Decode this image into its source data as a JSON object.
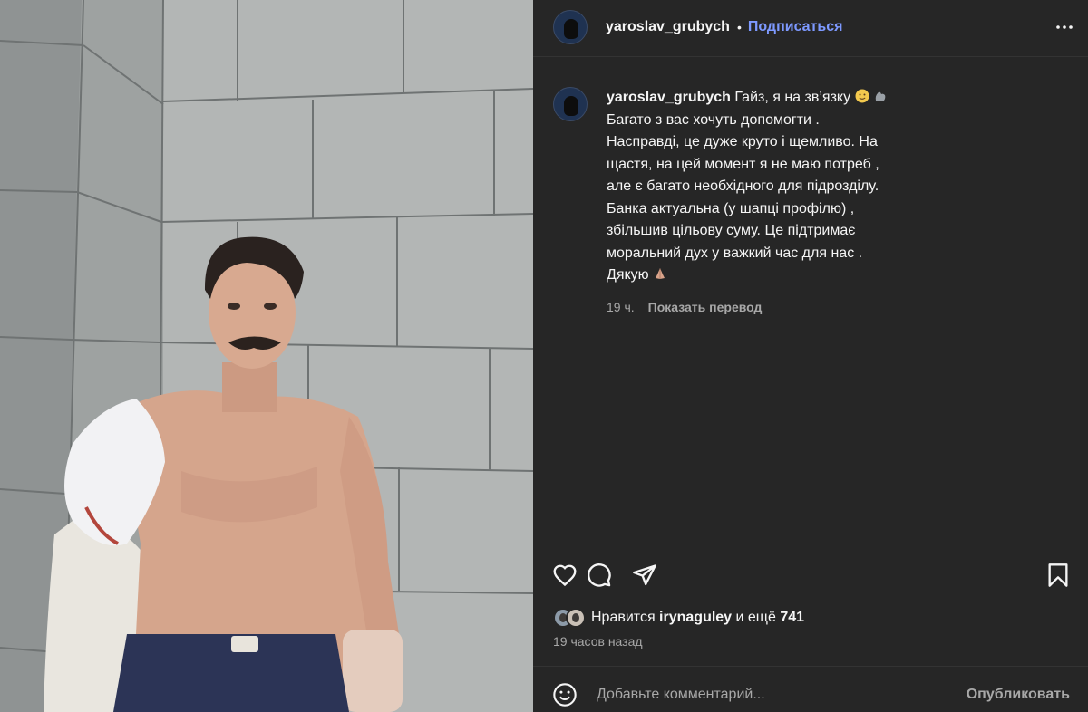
{
  "post": {
    "username": "yaroslav_grubych",
    "separator": "•",
    "follow_label": "Подписаться",
    "more_icon": "more-horizontal-icon"
  },
  "caption": {
    "username": "yaroslav_grubych",
    "line1": " Гайз, я на зв’язку ",
    "body": "Багато з вас хочуть допомогти . Насправді, це дуже круто і щемливо. На щастя, на цей момент я не маю потреб , але є багато необхідного для підрозділу. Банка актуальна (у шапці профілю) , збільшив цільову суму. Це підтримає моральний дух у важкий час для нас . Дякую ",
    "emojis": [
      "slightly-smiling-face-emoji",
      "flexed-biceps-emoji",
      "folded-hands-emoji"
    ],
    "time": "19 ч.",
    "translate_label": "Показать перевод"
  },
  "actions": {
    "like_icon": "heart-icon",
    "comment_icon": "comment-icon",
    "share_icon": "send-icon",
    "save_icon": "bookmark-icon"
  },
  "likes": {
    "prefix": "Нравится ",
    "user": "irynaguley",
    "middle": " и ещё ",
    "count": "741"
  },
  "posted_ago": "19 часов назад",
  "comment_box": {
    "emoji_icon": "smiley-icon",
    "placeholder": "Добавьте комментарий...",
    "publish_label": "Опубликовать"
  },
  "colors": {
    "panel_bg": "#262626",
    "accent_link": "#7d99ff",
    "muted_text": "#a8a8a8"
  }
}
